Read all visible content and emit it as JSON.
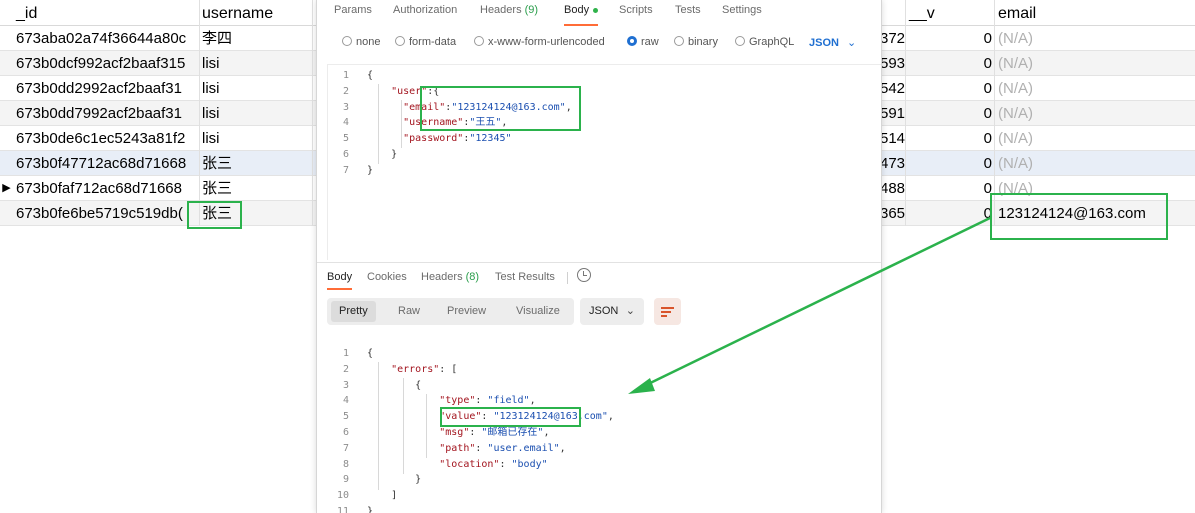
{
  "db": {
    "headers": {
      "id": "_id",
      "username": "username",
      "hidden": "",
      "v": "__v",
      "email": "email"
    },
    "rows": [
      {
        "marker": "",
        "id": "673aba02a74f36644a80c",
        "username": "李四",
        "hidden": "372",
        "v": "0",
        "email": "(N/A)",
        "email_na": true
      },
      {
        "marker": "",
        "id": "673b0dcf992acf2baaf315",
        "username": "lisi",
        "hidden": "593",
        "v": "0",
        "email": "(N/A)",
        "email_na": true
      },
      {
        "marker": "",
        "id": "673b0dd2992acf2baaf31",
        "username": "lisi",
        "hidden": "542",
        "v": "0",
        "email": "(N/A)",
        "email_na": true
      },
      {
        "marker": "",
        "id": "673b0dd7992acf2baaf31",
        "username": "lisi",
        "hidden": "591",
        "v": "0",
        "email": "(N/A)",
        "email_na": true
      },
      {
        "marker": "",
        "id": "673b0de6c1ec5243a81f2",
        "username": "lisi",
        "hidden": "514",
        "v": "0",
        "email": "(N/A)",
        "email_na": true
      },
      {
        "marker": "",
        "id": "673b0f47712ac68d71668",
        "username": "张三",
        "hidden": "473",
        "v": "0",
        "email": "(N/A)",
        "email_na": true
      },
      {
        "marker": "▶",
        "id": "673b0faf712ac68d71668",
        "username": "张三",
        "hidden": "488",
        "v": "0",
        "email": "(N/A)",
        "email_na": true
      },
      {
        "marker": "",
        "id": "673b0fe6be5719c519db(",
        "username": "张三",
        "hidden": "365",
        "v": "0",
        "email": "123124124@163.com",
        "email_na": false
      }
    ]
  },
  "postman": {
    "tabs": [
      {
        "label": "Params",
        "count": ""
      },
      {
        "label": "Authorization",
        "count": ""
      },
      {
        "label": "Headers",
        "count": "(9)"
      },
      {
        "label": "Body",
        "count": "",
        "active": true
      },
      {
        "label": "Scripts",
        "count": ""
      },
      {
        "label": "Tests",
        "count": ""
      },
      {
        "label": "Settings",
        "count": ""
      }
    ],
    "body_types": [
      {
        "label": "none",
        "on": false
      },
      {
        "label": "form-data",
        "on": false
      },
      {
        "label": "x-www-form-urlencoded",
        "on": false
      },
      {
        "label": "raw",
        "on": true
      },
      {
        "label": "binary",
        "on": false
      },
      {
        "label": "GraphQL",
        "on": false
      }
    ],
    "raw_format": "JSON",
    "request_lines": [
      [
        [
          "p",
          "{"
        ]
      ],
      [
        [
          "p",
          "    "
        ],
        [
          "k",
          "\"user\""
        ],
        [
          "p",
          ":{"
        ]
      ],
      [
        [
          "p",
          "      "
        ],
        [
          "k",
          "\"email\""
        ],
        [
          "p",
          ":"
        ],
        [
          "s",
          "\"123124124@163.com\""
        ],
        [
          "p",
          ","
        ]
      ],
      [
        [
          "p",
          "      "
        ],
        [
          "k",
          "\"username\""
        ],
        [
          "p",
          ":"
        ],
        [
          "s",
          "\"王五\""
        ],
        [
          "p",
          ","
        ]
      ],
      [
        [
          "p",
          "      "
        ],
        [
          "k",
          "\"password\""
        ],
        [
          "p",
          ":"
        ],
        [
          "s",
          "\"12345\""
        ]
      ],
      [
        [
          "p",
          "    }"
        ]
      ],
      [
        [
          "p",
          "}"
        ]
      ]
    ],
    "response_tabs": [
      {
        "label": "Body",
        "count": "",
        "active": true
      },
      {
        "label": "Cookies",
        "count": ""
      },
      {
        "label": "Headers",
        "count": "(8)"
      },
      {
        "label": "Test Results",
        "count": ""
      }
    ],
    "view_modes": [
      {
        "label": "Pretty",
        "on": true
      },
      {
        "label": "Raw",
        "on": false
      },
      {
        "label": "Preview",
        "on": false
      },
      {
        "label": "Visualize",
        "on": false
      }
    ],
    "response_format": "JSON",
    "response_lines": [
      [
        [
          "p",
          "{"
        ]
      ],
      [
        [
          "p",
          "    "
        ],
        [
          "k",
          "\"errors\""
        ],
        [
          "p",
          ": ["
        ]
      ],
      [
        [
          "p",
          "        {"
        ]
      ],
      [
        [
          "p",
          "            "
        ],
        [
          "k",
          "\"type\""
        ],
        [
          "p",
          ": "
        ],
        [
          "s",
          "\"field\""
        ],
        [
          "p",
          ","
        ]
      ],
      [
        [
          "p",
          "            "
        ],
        [
          "k",
          "\"value\""
        ],
        [
          "p",
          ": "
        ],
        [
          "s",
          "\"123124124@163.com\""
        ],
        [
          "p",
          ","
        ]
      ],
      [
        [
          "p",
          "            "
        ],
        [
          "k",
          "\"msg\""
        ],
        [
          "p",
          ": "
        ],
        [
          "s",
          "\"邮箱已存在\""
        ],
        [
          "p",
          ","
        ]
      ],
      [
        [
          "p",
          "            "
        ],
        [
          "k",
          "\"path\""
        ],
        [
          "p",
          ": "
        ],
        [
          "s",
          "\"user.email\""
        ],
        [
          "p",
          ","
        ]
      ],
      [
        [
          "p",
          "            "
        ],
        [
          "k",
          "\"location\""
        ],
        [
          "p",
          ": "
        ],
        [
          "s",
          "\"body\""
        ]
      ],
      [
        [
          "p",
          "        }"
        ]
      ],
      [
        [
          "p",
          "    ]"
        ]
      ],
      [
        [
          "p",
          "}"
        ]
      ]
    ]
  },
  "colors": {
    "annotation": "#2bb24c",
    "accent_tab": "#ff6c37",
    "json_key": "#a3151f",
    "json_string": "#1b4fb0"
  }
}
